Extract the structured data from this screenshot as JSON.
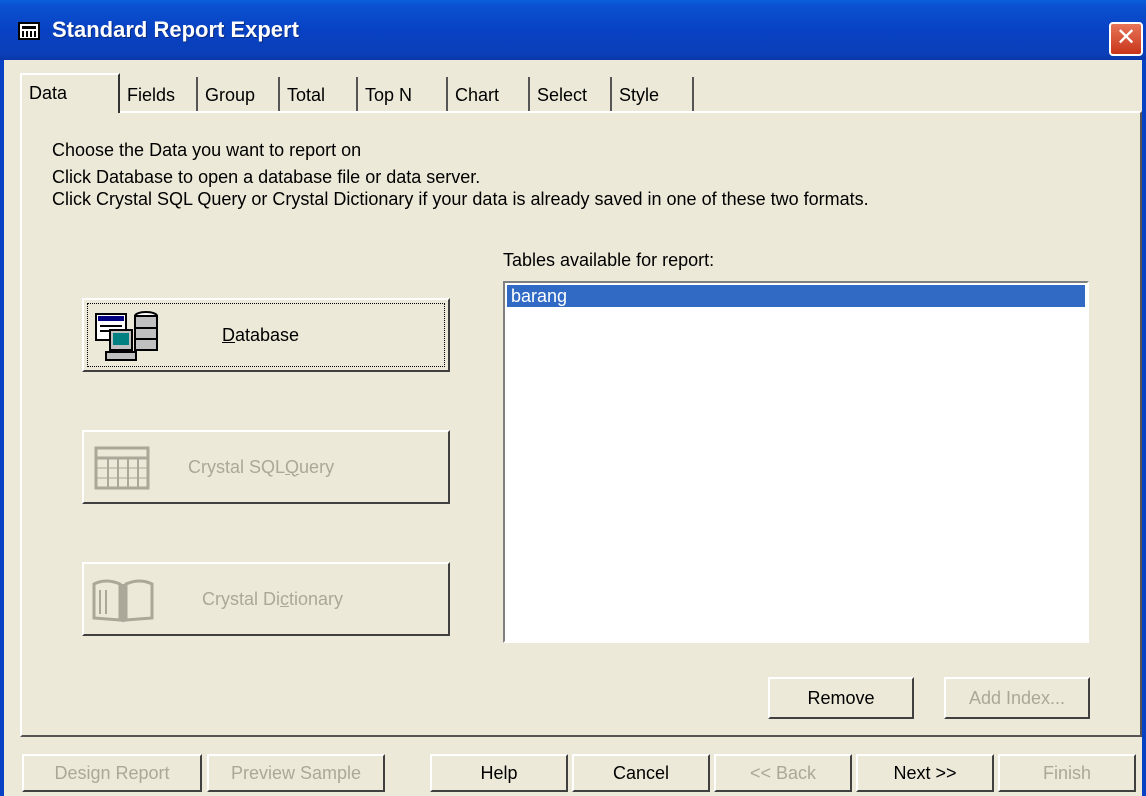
{
  "window": {
    "title": "Standard Report Expert",
    "close_icon": "close-icon"
  },
  "tabs": [
    {
      "label": "Data",
      "active": true
    },
    {
      "label": "Fields"
    },
    {
      "label": "Group"
    },
    {
      "label": "Total"
    },
    {
      "label": "Top N"
    },
    {
      "label": "Chart"
    },
    {
      "label": "Select"
    },
    {
      "label": "Style"
    }
  ],
  "instructions": {
    "line1": "Choose the Data you want to report on",
    "line2": "Click Database to open a database file or data server.",
    "line3": "Click Crystal SQL Query or Crystal Dictionary if your data is already saved in one of these two formats."
  },
  "source_buttons": {
    "database": {
      "label_pre": "",
      "label_u": "D",
      "label_post": "atabase",
      "enabled": true,
      "icon": "database-icon"
    },
    "sql_query": {
      "label_pre": "Crystal SQL ",
      "label_u": "Q",
      "label_post": "uery",
      "enabled": false,
      "icon": "sql-query-icon"
    },
    "dictionary": {
      "label_pre": "Crystal Di",
      "label_u": "c",
      "label_post": "tionary",
      "enabled": false,
      "icon": "dictionary-icon"
    }
  },
  "tables": {
    "label": "Tables available for report:",
    "items": [
      "barang"
    ],
    "selected_index": 0
  },
  "list_buttons": {
    "remove": "Remove",
    "add_index": "Add Index..."
  },
  "footer": {
    "design_report": "Design Report",
    "preview_sample": "Preview Sample",
    "help": "Help",
    "cancel": "Cancel",
    "back": "<< Back",
    "next": "Next >>",
    "finish": "Finish"
  },
  "colors": {
    "titlebar": "#0842c4",
    "selection": "#316ac5",
    "dialog_bg": "#ece9d8",
    "disabled_text": "#aca899"
  }
}
